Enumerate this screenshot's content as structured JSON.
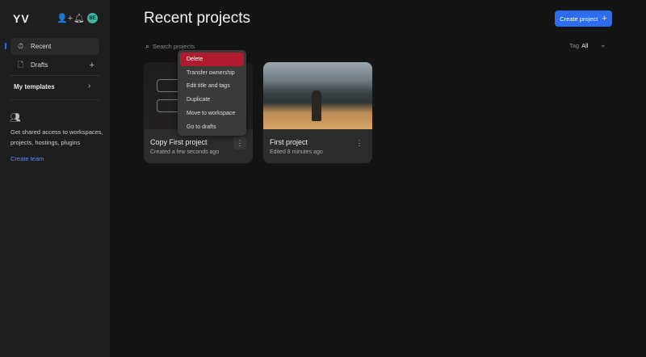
{
  "sidebar": {
    "logo": "YV",
    "avatar": "BE",
    "items": [
      {
        "label": "Recent",
        "icon": "stopwatch-icon"
      },
      {
        "label": "Drafts",
        "icon": "file-icon"
      }
    ],
    "templates": "My templates",
    "team_text": "Get shared access to workspaces, projects, hostings, plugins",
    "create_team": "Create team"
  },
  "header": {
    "title": "Recent projects",
    "create_button": "Create project"
  },
  "search": {
    "placeholder": "Search projects"
  },
  "tag": {
    "label": "Tag",
    "value": "All"
  },
  "projects": [
    {
      "title": "Copy First project",
      "subtitle": "Created a few seconds ago"
    },
    {
      "title": "First project",
      "subtitle": "Edited 8 minutes ago"
    }
  ],
  "menu": [
    "Delete",
    "Transfer ownership",
    "Edit title and tags",
    "Duplicate",
    "Move to workspace",
    "Go to drafts"
  ],
  "colors": {
    "accent": "#2d6cf0",
    "danger": "#b01c2e",
    "avatar": "#3fb59b"
  }
}
